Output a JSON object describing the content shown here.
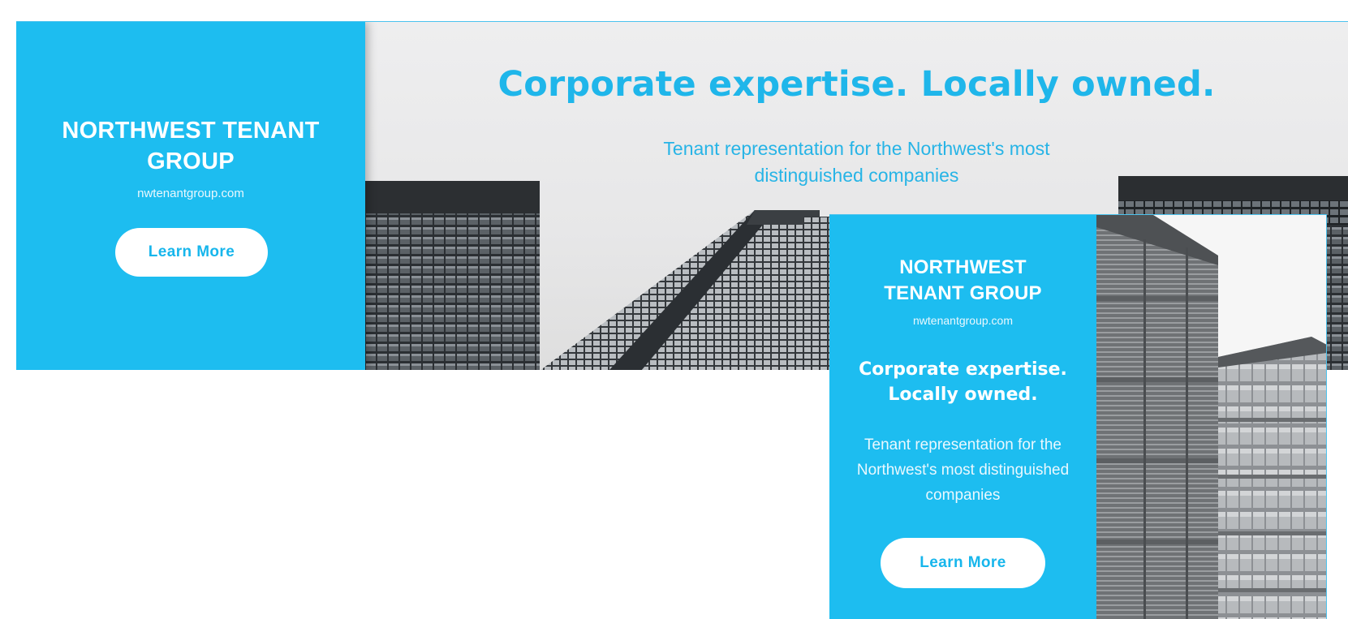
{
  "leaderboard": {
    "brand": "NORTHWEST TENANT GROUP",
    "url": "nwtenantgroup.com",
    "button_label": "Learn More",
    "headline": "Corporate expertise. Locally owned.",
    "subheadline": "Tenant representation for the Northwest's most distinguished companies"
  },
  "rectangle": {
    "brand": "NORTHWEST TENANT GROUP",
    "url": "nwtenantgroup.com",
    "headline": "Corporate expertise. Locally owned.",
    "subheadline": "Tenant representation for the Northwest's most distinguished companies",
    "button_label": "Learn More"
  },
  "colors": {
    "brand_blue": "#1dbdf0",
    "button_text": "#17b6ec",
    "headline_blue": "#1fb6ea"
  }
}
